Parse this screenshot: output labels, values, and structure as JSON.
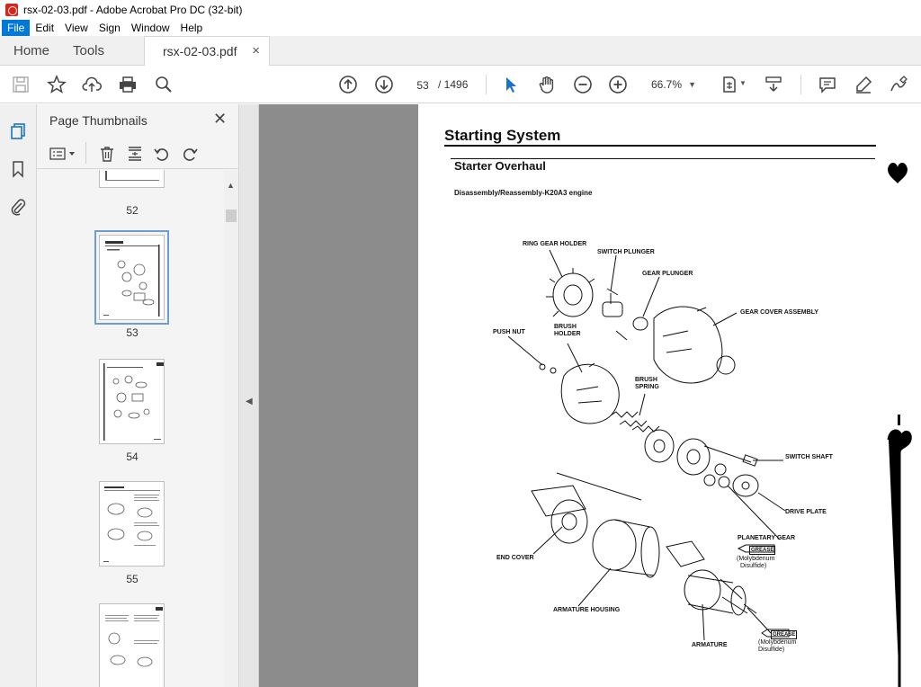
{
  "window": {
    "title": "rsx-02-03.pdf - Adobe Acrobat Pro DC (32-bit)"
  },
  "menu": [
    "File",
    "Edit",
    "View",
    "Sign",
    "Window",
    "Help"
  ],
  "tabs": {
    "home": "Home",
    "tools": "Tools",
    "document": "rsx-02-03.pdf",
    "close": "×"
  },
  "toolbar": {
    "current_page": "53",
    "total_pages": "/ 1496",
    "zoom": "66.7%"
  },
  "thumbnails": {
    "title": "Page Thumbnails",
    "close": "✕",
    "pages": [
      "52",
      "53",
      "54",
      "55"
    ]
  },
  "page": {
    "title": "Starting System",
    "subtitle": "Starter Overhaul",
    "caption": "Disassembly/Reassembly-K20A3 engine",
    "labels": {
      "ring_gear_holder": "RING GEAR HOLDER",
      "switch_plunger": "SWITCH PLUNGER",
      "gear_plunger": "GEAR PLUNGER",
      "gear_cover_assembly": "GEAR COVER ASSEMBLY",
      "push_nut": "PUSH NUT",
      "brush_holder_1": "BRUSH",
      "brush_holder_2": "HOLDER",
      "brush_spring_1": "BRUSH",
      "brush_spring_2": "SPRING",
      "switch_shaft": "SWITCH SHAFT",
      "drive_plate": "DRIVE PLATE",
      "planetary_gear": "PLANETARY GEAR",
      "grease": "GREASE",
      "moly_1": "(Molybdenum",
      "moly_2": "Disulfide)",
      "end_cover": "END COVER",
      "armature_housing": "ARMATURE HOUSING",
      "armature": "ARMATURE"
    }
  }
}
